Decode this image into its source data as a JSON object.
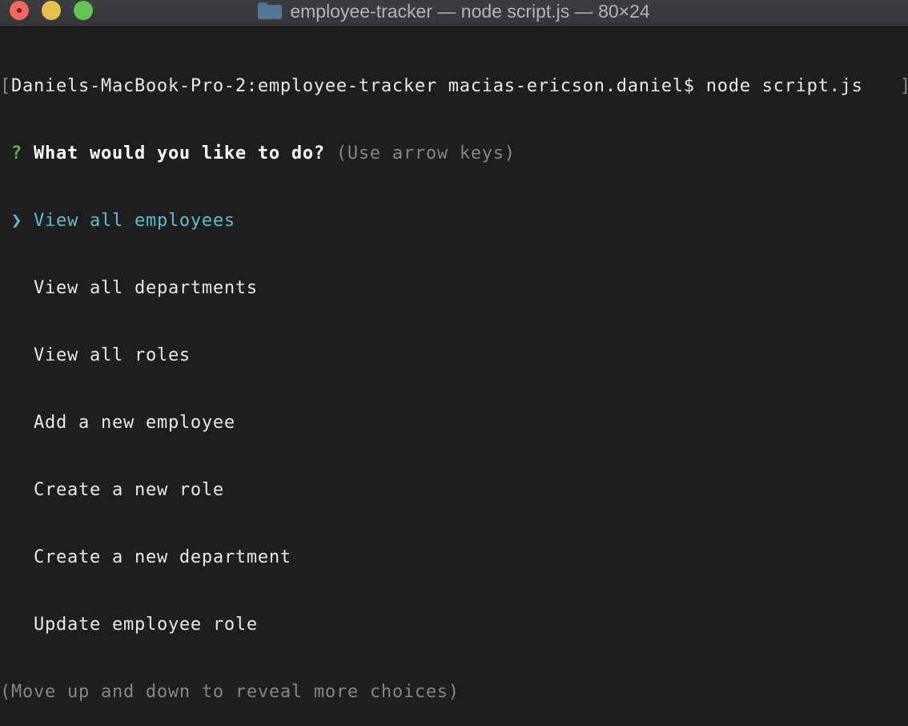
{
  "window": {
    "title": "employee-tracker — node script.js — 80×24",
    "folder_icon": "folder-icon",
    "controls": [
      "close",
      "minimize",
      "zoom"
    ]
  },
  "terminal": {
    "prompt_line": {
      "bracket_open": "[",
      "prompt": "Daniels-MacBook-Pro-2:employee-tracker macias-ericson.daniel$ ",
      "command": "node script.js",
      "bracket_close": "]"
    },
    "question": {
      "marker": "?",
      "text": "What would you like to do?",
      "hint": "(Use arrow keys)"
    },
    "pointer": "❯",
    "choices": [
      {
        "label": "View all employees",
        "selected": true
      },
      {
        "label": "View all departments",
        "selected": false
      },
      {
        "label": "View all roles",
        "selected": false
      },
      {
        "label": "Add a new employee",
        "selected": false
      },
      {
        "label": "Create a new role",
        "selected": false
      },
      {
        "label": "Create a new department",
        "selected": false
      },
      {
        "label": "Update employee role",
        "selected": false
      }
    ],
    "footer_hint": "(Move up and down to reveal more choices)"
  },
  "colors": {
    "background": "#1e1e1e",
    "question_mark": "#5fb549",
    "selected": "#5bbfce",
    "hint": "#868686"
  }
}
